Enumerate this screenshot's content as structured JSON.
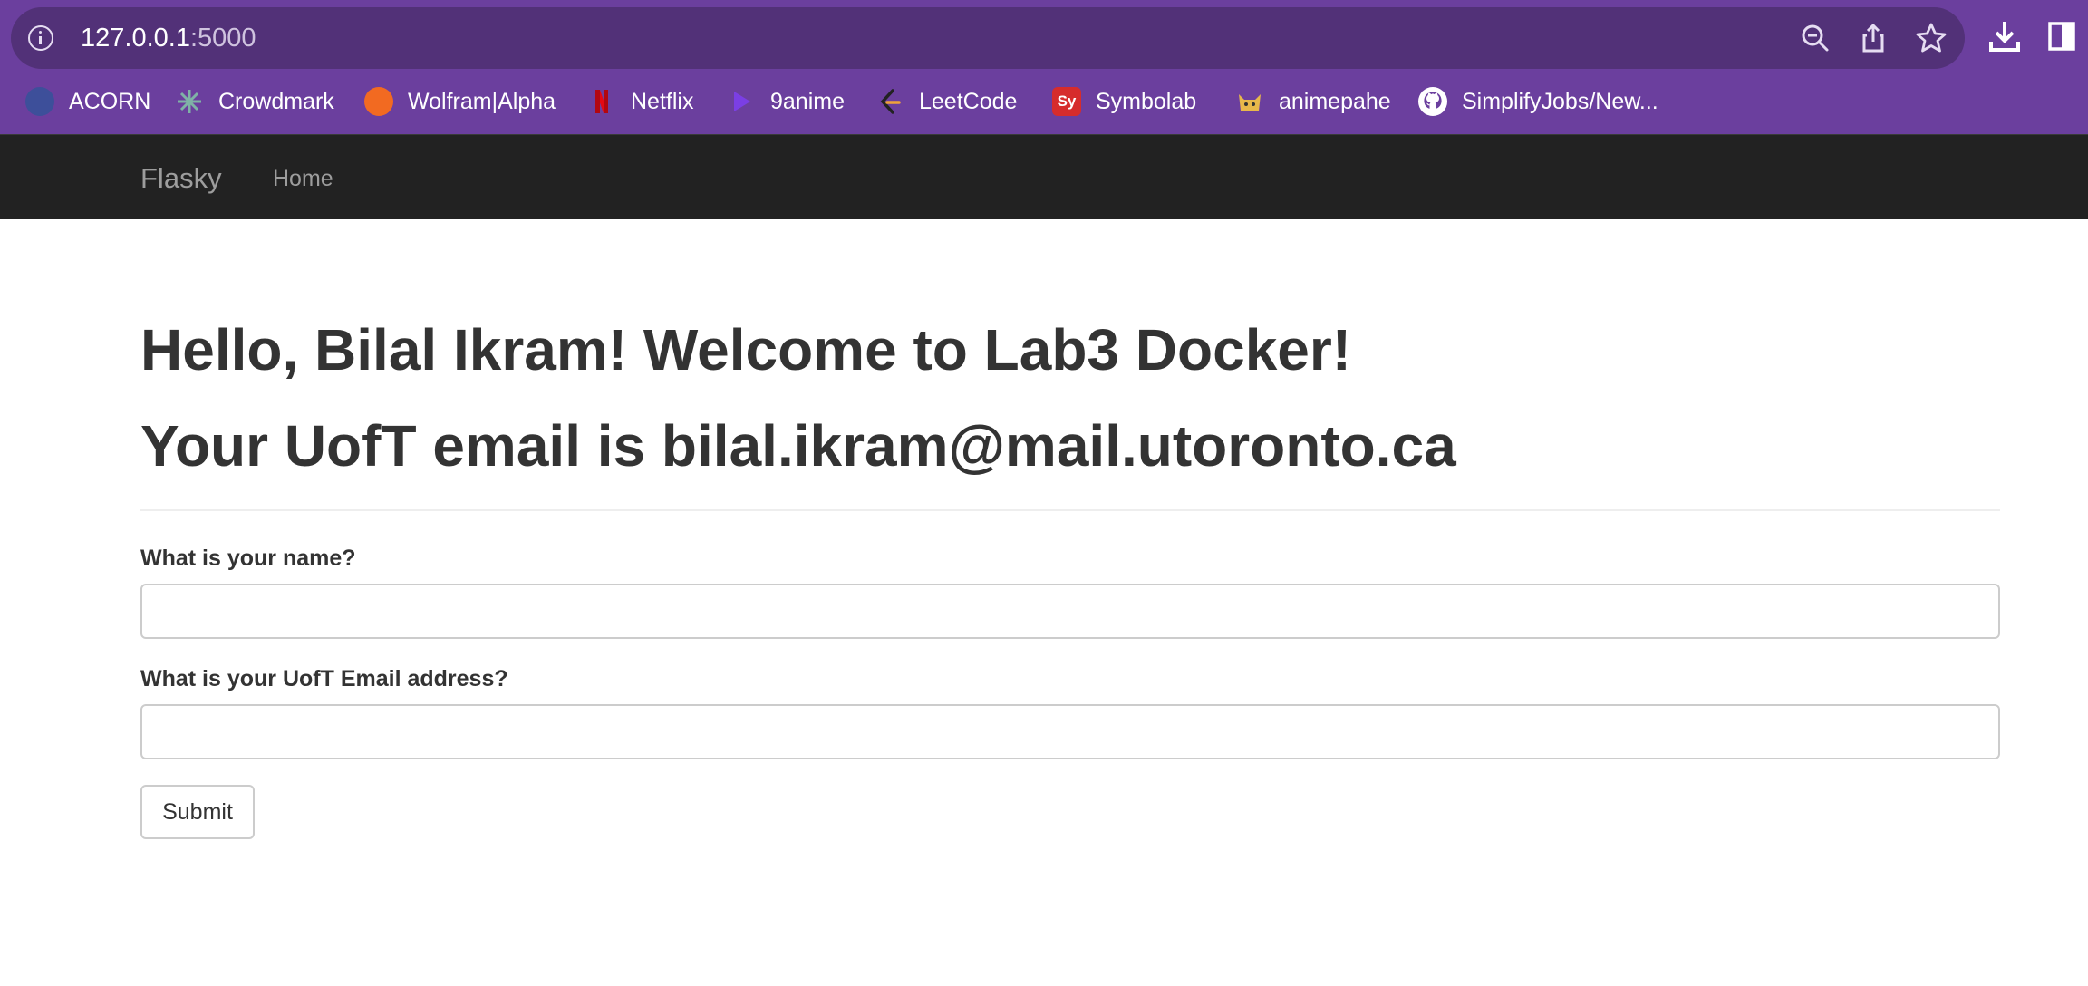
{
  "browser": {
    "url_host": "127.0.0.1",
    "url_port": ":5000",
    "bookmarks": [
      {
        "label": "ACORN",
        "icon": "acorn-icon",
        "color": "#4a5fb0"
      },
      {
        "label": "Crowdmark",
        "icon": "crowdmark-icon",
        "color": "#7fb3a6"
      },
      {
        "label": "Wolfram|Alpha",
        "icon": "wolfram-icon",
        "color": "#f26a21"
      },
      {
        "label": "Netflix",
        "icon": "netflix-icon",
        "color": "#e50914"
      },
      {
        "label": "9anime",
        "icon": "9anime-icon",
        "color": "#7b3fe4"
      },
      {
        "label": "LeetCode",
        "icon": "leetcode-icon",
        "color": "#f0a33a"
      },
      {
        "label": "Symbolab",
        "icon": "symbolab-icon",
        "color": "#d62c2c",
        "glyph": "Sy"
      },
      {
        "label": "animepahe",
        "icon": "animepahe-icon",
        "color": "#e8b84a"
      },
      {
        "label": "SimplifyJobs/New...",
        "icon": "github-icon",
        "color": "#ffffff"
      }
    ]
  },
  "navbar": {
    "brand": "Flasky",
    "home": "Home"
  },
  "page": {
    "greeting": "Hello, Bilal Ikram! Welcome to Lab3 Docker!",
    "email_line": "Your UofT email is bilal.ikram@mail.utoronto.ca",
    "form": {
      "name_label": "What is your name?",
      "name_value": "",
      "email_label": "What is your UofT Email address?",
      "email_value": "",
      "submit_label": "Submit"
    }
  },
  "colors": {
    "chrome_purple": "#6b3f9e",
    "omnibox_purple": "#523178",
    "navbar_bg": "#222222",
    "text": "#333333"
  }
}
